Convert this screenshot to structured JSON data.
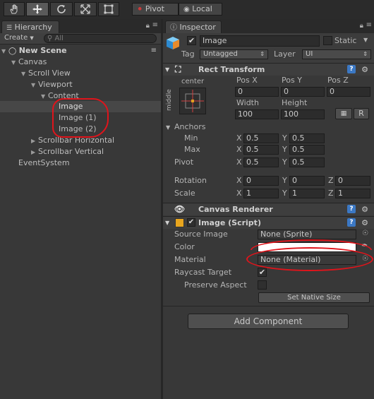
{
  "toolbar": {
    "tools": [
      {
        "name": "hand-tool",
        "label": "hand"
      },
      {
        "name": "move-tool",
        "label": "move"
      },
      {
        "name": "rotate-tool",
        "label": "rotate"
      },
      {
        "name": "scale-tool",
        "label": "scale"
      },
      {
        "name": "rect-tool",
        "label": "rect"
      }
    ],
    "pivot_label": "Pivot",
    "local_label": "Local"
  },
  "hierarchy": {
    "tab_title": "Hierarchy",
    "create_label": "Create",
    "search_placeholder": "All",
    "scene_name": "New Scene",
    "items": [
      {
        "label": "Canvas"
      },
      {
        "label": "Scroll View"
      },
      {
        "label": "Viewport"
      },
      {
        "label": "Content"
      },
      {
        "label": "Image"
      },
      {
        "label": "Image (1)"
      },
      {
        "label": "Image (2)"
      },
      {
        "label": "Scrollbar Horizontal"
      },
      {
        "label": "Scrollbar Vertical"
      },
      {
        "label": "EventSystem"
      }
    ]
  },
  "inspector": {
    "tab_title": "Inspector",
    "object_name": "Image",
    "static_label": "Static",
    "tag_label": "Tag",
    "tag_value": "Untagged",
    "layer_label": "Layer",
    "layer_value": "UI",
    "rect_transform": {
      "title": "Rect Transform",
      "anchor_preset_top": "center",
      "anchor_preset_side": "middle",
      "pos_x_label": "Pos X",
      "pos_y_label": "Pos Y",
      "pos_z_label": "Pos Z",
      "pos_x": "0",
      "pos_y": "0",
      "pos_z": "0",
      "width_label": "Width",
      "height_label": "Height",
      "width": "100",
      "height": "100",
      "r_label": "R",
      "anchors_label": "Anchors",
      "min_label": "Min",
      "max_label": "Max",
      "min_x": "0.5",
      "min_y": "0.5",
      "max_x": "0.5",
      "max_y": "0.5",
      "pivot_label": "Pivot",
      "pivot_x": "0.5",
      "pivot_y": "0.5",
      "rotation_label": "Rotation",
      "rot_x": "0",
      "rot_y": "0",
      "rot_z": "0",
      "scale_label": "Scale",
      "scale_x": "1",
      "scale_y": "1",
      "scale_z": "1",
      "x": "X",
      "y": "Y",
      "z": "Z"
    },
    "canvas_renderer": {
      "title": "Canvas Renderer"
    },
    "image_script": {
      "title": "Image (Script)",
      "source_image_label": "Source Image",
      "source_image_value": "None (Sprite)",
      "color_label": "Color",
      "material_label": "Material",
      "material_value": "None (Material)",
      "raycast_label": "Raycast Target",
      "preserve_label": "Preserve Aspect",
      "native_size_label": "Set Native Size"
    },
    "add_component_label": "Add Component"
  },
  "colors": {
    "annotation": "#e0141b",
    "selection": "#474747"
  }
}
